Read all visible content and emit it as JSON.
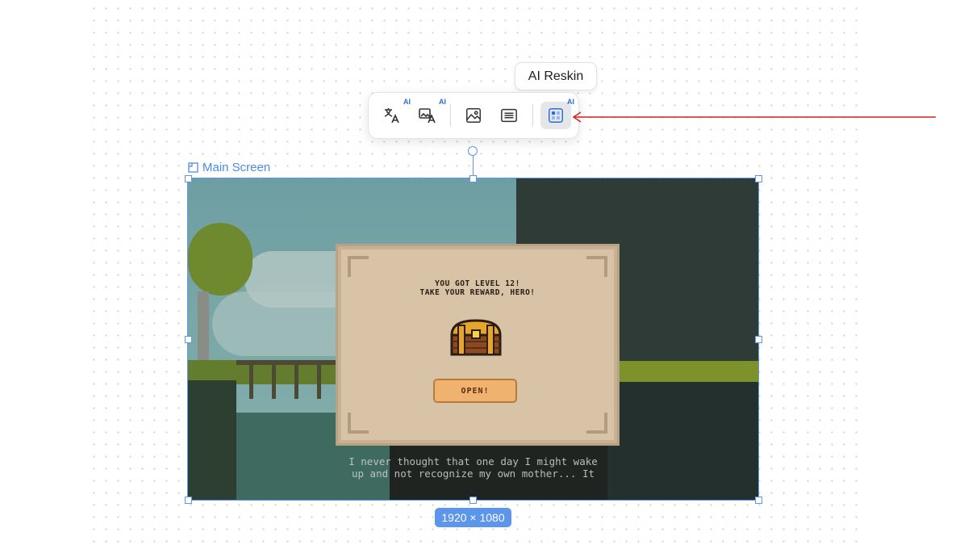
{
  "tooltip": {
    "label": "AI Reskin"
  },
  "toolbar": {
    "ai_badge": "AI",
    "buttons": [
      {
        "name": "translate-ai",
        "icon": "translate-icon",
        "ai": true
      },
      {
        "name": "image-translate-ai",
        "icon": "image-translate-icon",
        "ai": true
      },
      {
        "name": "image",
        "icon": "image-icon",
        "ai": false
      },
      {
        "name": "text",
        "icon": "text-lines-icon",
        "ai": false
      },
      {
        "name": "ai-reskin",
        "icon": "reskin-icon",
        "ai": true,
        "active": true
      }
    ]
  },
  "frame": {
    "label": "Main Screen",
    "size": "1920 × 1080"
  },
  "game": {
    "popup_line1": "YOU GOT LEVEL 12!",
    "popup_line2": "TAKE YOUR REWARD, HERO!",
    "open_button": "OPEN!",
    "dialogue_line1": "I never thought that one day I might wake",
    "dialogue_line2": "up and not recognize my own mother... It"
  },
  "colors": {
    "accent": "#5b95ec",
    "ai_blue": "#2b6fd6",
    "annotation_arrow": "#d32020"
  }
}
